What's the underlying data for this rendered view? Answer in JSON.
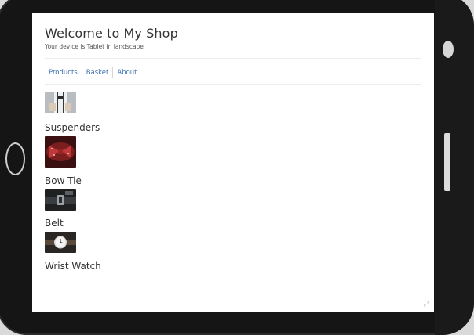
{
  "header": {
    "title": "Welcome to My Shop",
    "subtitle": "Your device is Tablet in landscape"
  },
  "nav": {
    "items": [
      {
        "label": "Products"
      },
      {
        "label": "Basket"
      },
      {
        "label": "About"
      }
    ]
  },
  "products": [
    {
      "name": "Suspenders"
    },
    {
      "name": "Bow Tie"
    },
    {
      "name": "Belt"
    },
    {
      "name": "Wrist Watch"
    }
  ],
  "colors": {
    "link": "#3b6fb0",
    "device_frame": "#151515"
  }
}
